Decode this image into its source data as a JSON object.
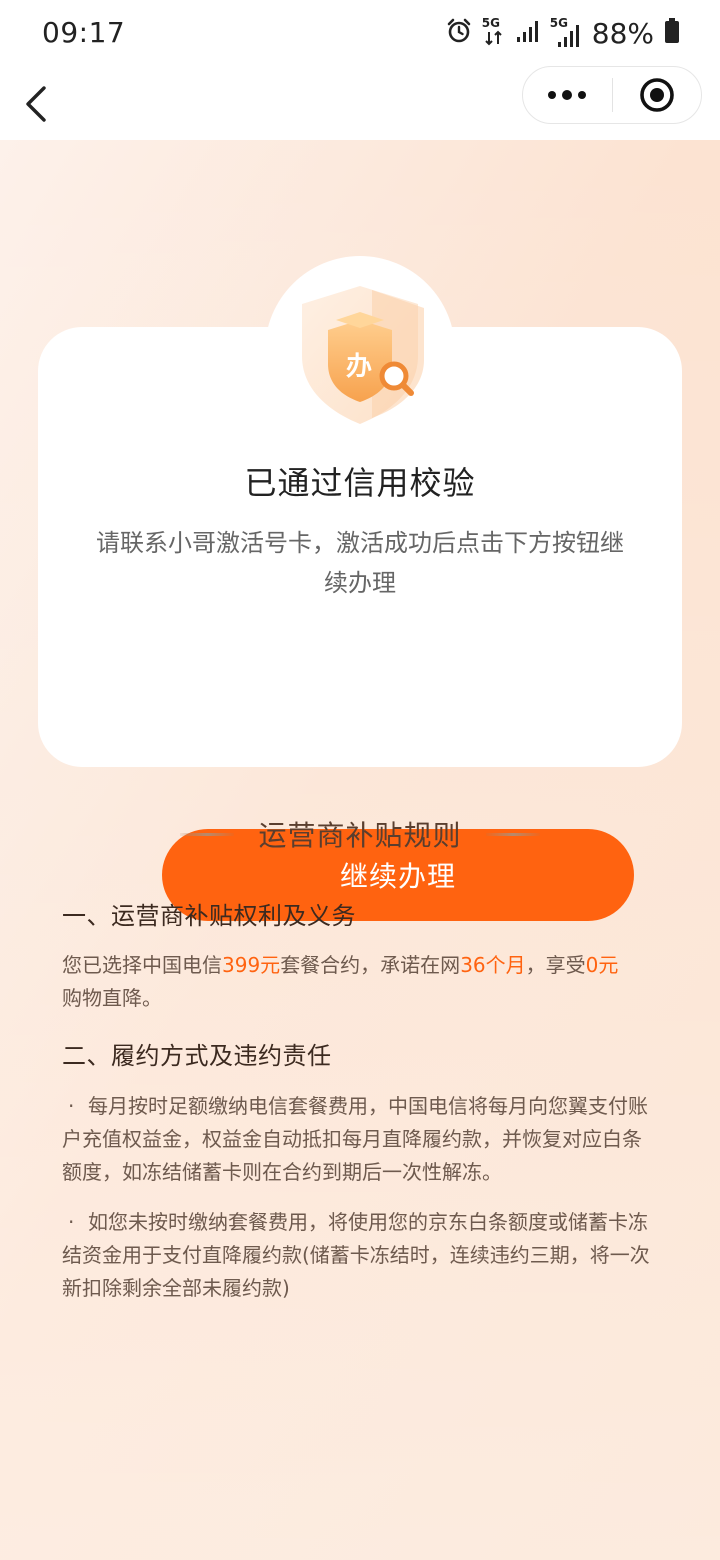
{
  "status": {
    "time": "09:17",
    "battery": "88%",
    "net1": "5G",
    "net2": "5G"
  },
  "nav": {
    "back_icon": "chevron-left-icon",
    "more_icon": "more-dots-icon",
    "target_icon": "target-circle-icon"
  },
  "card": {
    "badge_icon": "shield-search-icon",
    "badge_text": "办",
    "title": "已通过信用校验",
    "desc": "请联系小哥激活号卡，激活成功后点击下方按钮继续办理",
    "button_label": "继续办理"
  },
  "rules": {
    "title": "运营商补贴规则",
    "section1_title": "一、运营商补贴权利及义务",
    "section1_p1": "您已选择中国电信",
    "section1_h1": "399元",
    "section1_p2": "套餐合约，承诺在网",
    "section1_h2": "36个月",
    "section1_p3": "，享受",
    "section1_h3": "0元",
    "section1_p4": "购物直降。",
    "section2_title": "二、履约方式及违约责任",
    "bullet_symbol": "·",
    "item1": "每月按时足额缴纳电信套餐费用，中国电信将每月向您翼支付账户充值权益金，权益金自动抵扣每月直降履约款，并恢复对应白条额度，如冻结储蓄卡则在合约到期后一次性解冻。",
    "item2": "如您未按时缴纳套餐费用，将使用您的京东白条额度或储蓄卡冻结资金用于支付直降履约款(储蓄卡冻结时，连续违约三期，将一次新扣除剩余全部未履约款)"
  },
  "colors": {
    "accent": "#ff6310",
    "background_gradient_start": "#fdf1ea",
    "background_gradient_end": "#fbe0cc"
  }
}
